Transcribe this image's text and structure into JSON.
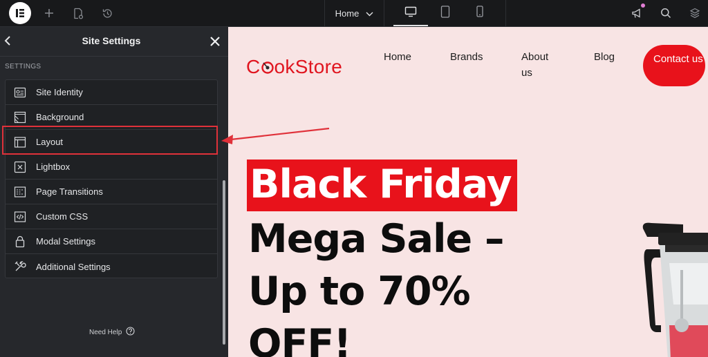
{
  "topbar": {
    "page_selector_label": "Home",
    "icons": [
      "elementor-logo-icon",
      "add-icon",
      "page-settings-icon",
      "history-icon",
      "chevron-down-icon",
      "desktop-icon",
      "tablet-icon",
      "mobile-icon",
      "announcements-icon",
      "search-icon",
      "structure-layers-icon"
    ]
  },
  "panel": {
    "title": "Site Settings",
    "section_label": "SETTINGS",
    "items": [
      {
        "label": "Site Identity",
        "icon": "site-identity-icon"
      },
      {
        "label": "Background",
        "icon": "background-icon"
      },
      {
        "label": "Layout",
        "icon": "layout-icon"
      },
      {
        "label": "Lightbox",
        "icon": "lightbox-icon"
      },
      {
        "label": "Page Transitions",
        "icon": "page-transitions-icon"
      },
      {
        "label": "Custom CSS",
        "icon": "custom-css-icon"
      },
      {
        "label": "Modal Settings",
        "icon": "modal-settings-icon"
      },
      {
        "label": "Additional Settings",
        "icon": "additional-settings-icon"
      }
    ],
    "need_help_label": "Need Help"
  },
  "preview": {
    "brand": {
      "text_pre": "",
      "text_first": "C",
      "text_rest": "okStore",
      "color": "#e0151f"
    },
    "nav": [
      {
        "label": "Home"
      },
      {
        "label": "Brands"
      },
      {
        "label": "About us"
      },
      {
        "label": "Blog"
      }
    ],
    "contact_label": "Contact us",
    "hero": {
      "highlight": "Black Friday",
      "line2": "Mega Sale –",
      "line3": "Up to 70%",
      "line4": "OFF!"
    }
  },
  "colors": {
    "accent_red": "#e8121b",
    "annotation_red": "#e0313a",
    "preview_bg": "#f8e4e4",
    "panel_bg": "#26282c"
  }
}
